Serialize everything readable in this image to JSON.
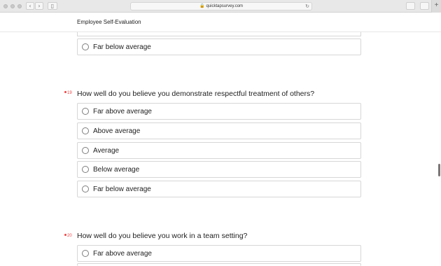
{
  "browser": {
    "url": "quicktapsurvey.com",
    "icons": [
      "lock-icon",
      "reload-icon",
      "share-icon",
      "tabs-icon",
      "new-tab-icon"
    ]
  },
  "survey": {
    "title": "Employee Self-Evaluation"
  },
  "previous_question": {
    "last_option": "Far below average"
  },
  "questions": [
    {
      "number": "19",
      "text": "How well do you believe you demonstrate respectful treatment of others?",
      "options": [
        "Far above average",
        "Above average",
        "Average",
        "Below average",
        "Far below average"
      ]
    },
    {
      "number": "20",
      "text": "How well do you believe you work in a team setting?",
      "options": [
        "Far above average"
      ]
    }
  ],
  "colors": {
    "required_marker": "#e44444",
    "border": "#d6d6d6"
  }
}
